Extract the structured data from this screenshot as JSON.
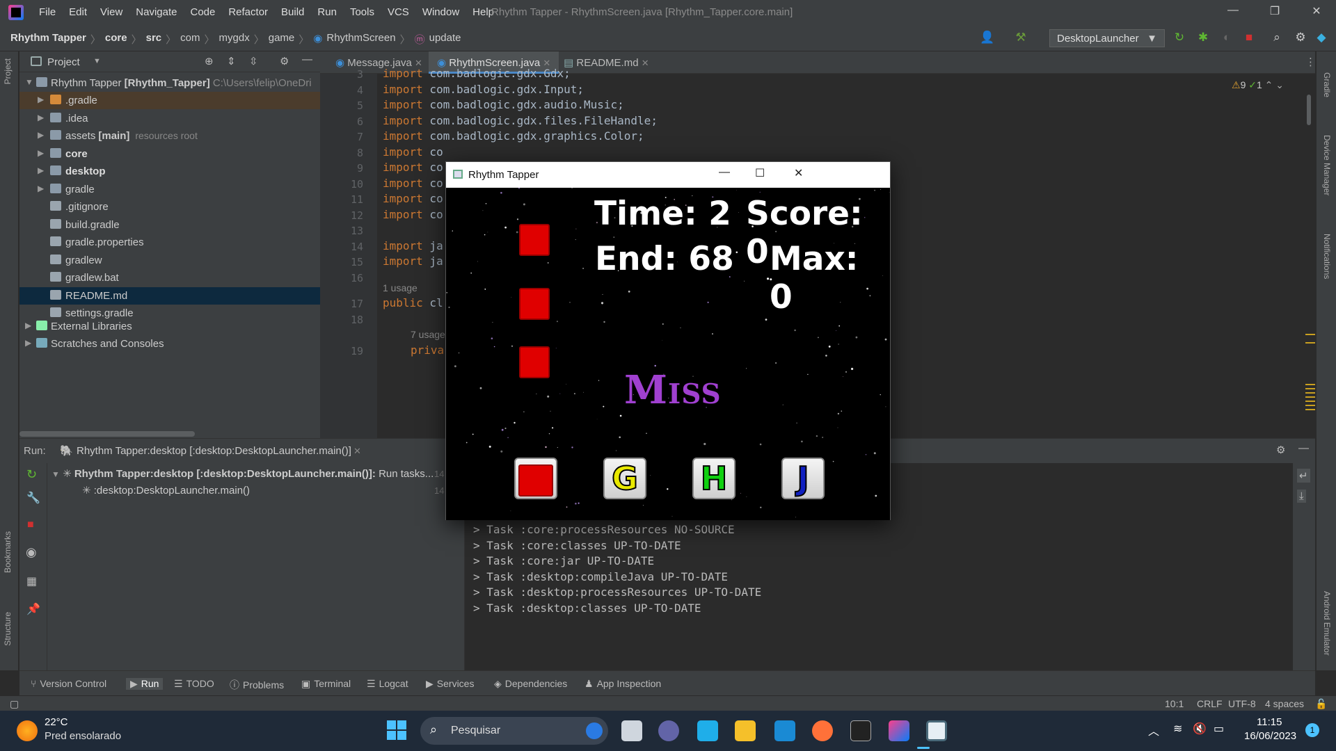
{
  "ide": {
    "menu": [
      "File",
      "Edit",
      "View",
      "Navigate",
      "Code",
      "Refactor",
      "Build",
      "Run",
      "Tools",
      "VCS",
      "Window",
      "Help"
    ],
    "window_title": "Rhythm Tapper - RhythmScreen.java [Rhythm_Tapper.core.main]",
    "breadcrumbs": [
      "Rhythm Tapper",
      "core",
      "src",
      "com",
      "mygdx",
      "game",
      "RhythmScreen",
      "update"
    ],
    "run_config": "DesktopLauncher",
    "left_strip": [
      "Project",
      "Bookmarks",
      "Structure"
    ],
    "right_strip": [
      "Gradle",
      "Device Manager",
      "Notifications",
      "Android Emulator"
    ]
  },
  "project": {
    "title": "Project",
    "root_name": "Rhythm Tapper",
    "root_module": "[Rhythm_Tapper]",
    "root_path": "C:\\Users\\felip\\OneDri",
    "items": [
      {
        "label": ".gradle"
      },
      {
        "label": ".idea"
      },
      {
        "label": "assets",
        "tag": "[main]",
        "note": "resources root"
      },
      {
        "label": "core"
      },
      {
        "label": "desktop"
      },
      {
        "label": "gradle"
      },
      {
        "label": ".gitignore"
      },
      {
        "label": "build.gradle"
      },
      {
        "label": "gradle.properties"
      },
      {
        "label": "gradlew"
      },
      {
        "label": "gradlew.bat"
      },
      {
        "label": "README.md"
      },
      {
        "label": "settings.gradle"
      }
    ],
    "extra": [
      "External Libraries",
      "Scratches and Consoles"
    ]
  },
  "editor": {
    "tabs": [
      "Message.java",
      "RhythmScreen.java",
      "README.md"
    ],
    "warnings": "9",
    "checks": "1",
    "line_numbers": [
      "3",
      "4",
      "5",
      "6",
      "7",
      "8",
      "9",
      "10",
      "11",
      "12",
      "13",
      "14",
      "15",
      "16",
      "17",
      "18",
      "19"
    ],
    "lines": [
      {
        "kw": "import",
        "rest": " com.badlogic.gdx.Gdx;"
      },
      {
        "kw": "import",
        "rest": " com.badlogic.gdx.Input;"
      },
      {
        "kw": "import",
        "rest": " com.badlogic.gdx.audio.Music;"
      },
      {
        "kw": "import",
        "rest": " com.badlogic.gdx.files.FileHandle;"
      },
      {
        "kw": "import",
        "rest": " com.badlogic.gdx.graphics.Color;"
      },
      {
        "kw": "import",
        "rest": " co"
      },
      {
        "kw": "import",
        "rest": " co"
      },
      {
        "kw": "import",
        "rest": " co"
      },
      {
        "kw": "import",
        "rest": " co"
      },
      {
        "kw": "import",
        "rest": " co"
      },
      {
        "kw": "",
        "rest": ""
      },
      {
        "kw": "import",
        "rest": " ja"
      },
      {
        "kw": "import",
        "rest": " ja"
      },
      {
        "kw": "",
        "rest": ""
      },
      {
        "kw": "public",
        "rest": " cl"
      },
      {
        "kw": "",
        "rest": ""
      },
      {
        "kw": "priva",
        "rest": ""
      }
    ],
    "usage_hint": "1 usage",
    "usage_hint2": "7 usage"
  },
  "run": {
    "label": "Run:",
    "tab": "Rhythm Tapper:desktop [:desktop:DesktopLauncher.main()]",
    "tree_root": "Rhythm Tapper:desktop [:desktop:DesktopLauncher.main()]:",
    "tree_root_suffix": "Run tasks...",
    "tree_child": ":desktop:DesktopLauncher.main()",
    "time1": "14",
    "time2": "14",
    "console": [
      "> Task :core:processResources NO-SOURCE",
      "> Task :core:classes UP-TO-DATE",
      "> Task :core:jar UP-TO-DATE",
      "> Task :desktop:compileJava UP-TO-DATE",
      "> Task :desktop:processResources UP-TO-DATE",
      "> Task :desktop:classes UP-TO-DATE"
    ]
  },
  "toolwindows": [
    "Version Control",
    "Run",
    "TODO",
    "Problems",
    "Terminal",
    "Logcat",
    "Services",
    "Dependencies",
    "App Inspection"
  ],
  "status": {
    "pos": "10:1",
    "eol": "CRLF",
    "enc": "UTF-8",
    "indent": "4 spaces"
  },
  "game": {
    "title": "Rhythm Tapper",
    "time": "Time: 2",
    "score": "Score: 0",
    "end": "End: 68",
    "max": "Max: 0",
    "feedback": "Miss",
    "keys": [
      "G",
      "H",
      "J"
    ],
    "key_colors": [
      "#e8e800",
      "#10d010",
      "#1020c0"
    ]
  },
  "taskbar": {
    "temp": "22°C",
    "weather": "Pred ensolarado",
    "search": "Pesquisar",
    "time": "11:15",
    "date": "16/06/2023",
    "badge": "1"
  }
}
